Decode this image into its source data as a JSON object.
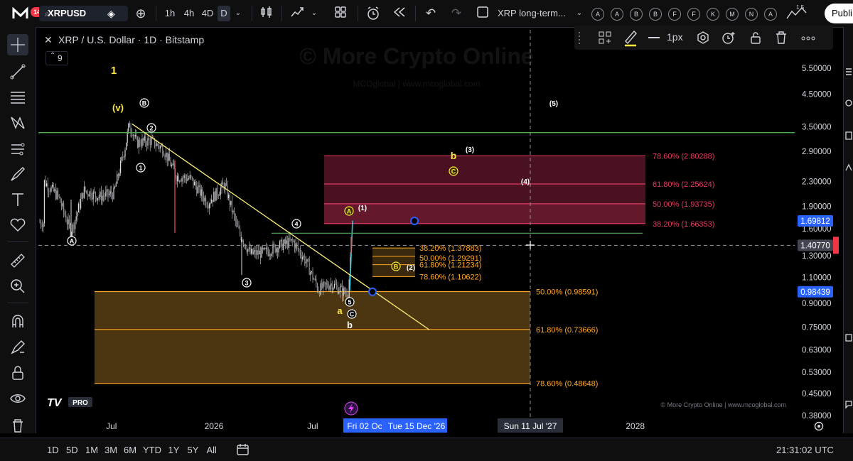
{
  "topbar": {
    "notif_count": "14",
    "symbol": "XRPUSD",
    "intervals": [
      "1h",
      "4h",
      "4D",
      "D"
    ],
    "layout_name": "XRP long-term...",
    "letters": [
      "A",
      "A",
      "B",
      "B",
      "F",
      "F",
      "K",
      "M",
      "N",
      "A"
    ],
    "publish_label": "Publi",
    "counter_text": "1 5"
  },
  "floatbar": {
    "width_label": "1px"
  },
  "legend": {
    "title": "XRP / U.S. Dollar · 1D · Bitstamp",
    "indicator_count": "9"
  },
  "watermark": {
    "main": "© More Crypto Online",
    "sub": "MCOglobal  |  www.mcoglobal.com",
    "footer": "© More Crypto Online  |  www.mcoglobal.com"
  },
  "brand": {
    "logo_text": "TV",
    "pro_label": "PRO"
  },
  "chart_data": {
    "type": "line",
    "symbol": "XRPUSD",
    "y_scale": "log",
    "price_ticks": [
      {
        "label": "5.50000",
        "value": 5.5
      },
      {
        "label": "4.50000",
        "value": 4.5
      },
      {
        "label": "3.50000",
        "value": 3.5
      },
      {
        "label": "2.90000",
        "value": 2.9
      },
      {
        "label": "2.30000",
        "value": 2.3
      },
      {
        "label": "1.90000",
        "value": 1.9
      },
      {
        "label": "1.60000",
        "value": 1.6
      },
      {
        "label": "1.30000",
        "value": 1.3
      },
      {
        "label": "1.10000",
        "value": 1.1
      },
      {
        "label": "0.90000",
        "value": 0.9
      },
      {
        "label": "0.75000",
        "value": 0.75
      },
      {
        "label": "0.63000",
        "value": 0.63
      },
      {
        "label": "0.53000",
        "value": 0.53
      },
      {
        "label": "0.45000",
        "value": 0.45
      },
      {
        "label": "0.38000",
        "value": 0.38
      }
    ],
    "price_labels": [
      {
        "label": "1.69812",
        "value": 1.69812,
        "color": "#2962ff"
      },
      {
        "label": "1.40770",
        "value": 1.4077,
        "color": "#434651"
      },
      {
        "label": "0.98439",
        "value": 0.98439,
        "color": "#2962ff"
      }
    ],
    "time_ticks": [
      {
        "label": "Jul",
        "pos": 0.1
      },
      {
        "label": "2026",
        "pos": 0.235
      },
      {
        "label": "Jul",
        "pos": 0.365
      },
      {
        "label": "2028",
        "pos": 0.79
      }
    ],
    "time_labels": [
      "Fri 02 Oc",
      "Tue 15 Dec '26",
      "Sun 11 Jul '27"
    ],
    "fib_upper": [
      {
        "label": "78.60% (2.80288)",
        "value": 2.80288
      },
      {
        "label": "61.80% (2.25624)",
        "value": 2.25624
      },
      {
        "label": "50.00% (1.93735)",
        "value": 1.93735
      },
      {
        "label": "38.20% (1.66353)",
        "value": 1.66353
      }
    ],
    "fib_mid": [
      {
        "label": "38.20% (1.37883)",
        "value": 1.37883
      },
      {
        "label": "50.00% (1.29291)",
        "value": 1.29291
      },
      {
        "label": "61.80% (1.21234)",
        "value": 1.21234
      },
      {
        "label": "78.60% (1.10622)",
        "value": 1.10622
      }
    ],
    "fib_lower": [
      {
        "label": "50.00% (0.98591)",
        "value": 0.98591
      },
      {
        "label": "61.80% (0.73666)",
        "value": 0.73666
      },
      {
        "label": "78.60% (0.48648)",
        "value": 0.48648
      }
    ],
    "horizontal_line": {
      "value": 3.35,
      "color": "#4caf50"
    },
    "annotations_yellow": [
      "1",
      "(v)",
      "a",
      "b"
    ],
    "annotations_white": [
      "(5)",
      "(3)",
      "(4)",
      "(1)",
      "(2)",
      "b"
    ],
    "wave_circled": [
      "A",
      "B",
      "1",
      "2",
      "3",
      "4",
      "5",
      "C"
    ],
    "wave_circled_orange": [
      "A",
      "B",
      "C"
    ],
    "colors": {
      "candle_up": "#dadada",
      "upper_zone": "#b02a4e",
      "upper_line": "#e03a63",
      "lower_zone": "#6a4a17",
      "lower_line": "#ffa726",
      "fib_text": "#ffa726",
      "trend_line": "#fff176",
      "yellow_label": "#ffeb3b",
      "green_line": "#4caf50",
      "accent": "#2962ff",
      "impulse": "#26c6da"
    }
  },
  "bottombar": {
    "ranges": [
      "1D",
      "5D",
      "1M",
      "3M",
      "6M",
      "YTD",
      "1Y",
      "5Y",
      "All"
    ],
    "clock": "21:31:02 UTC"
  }
}
